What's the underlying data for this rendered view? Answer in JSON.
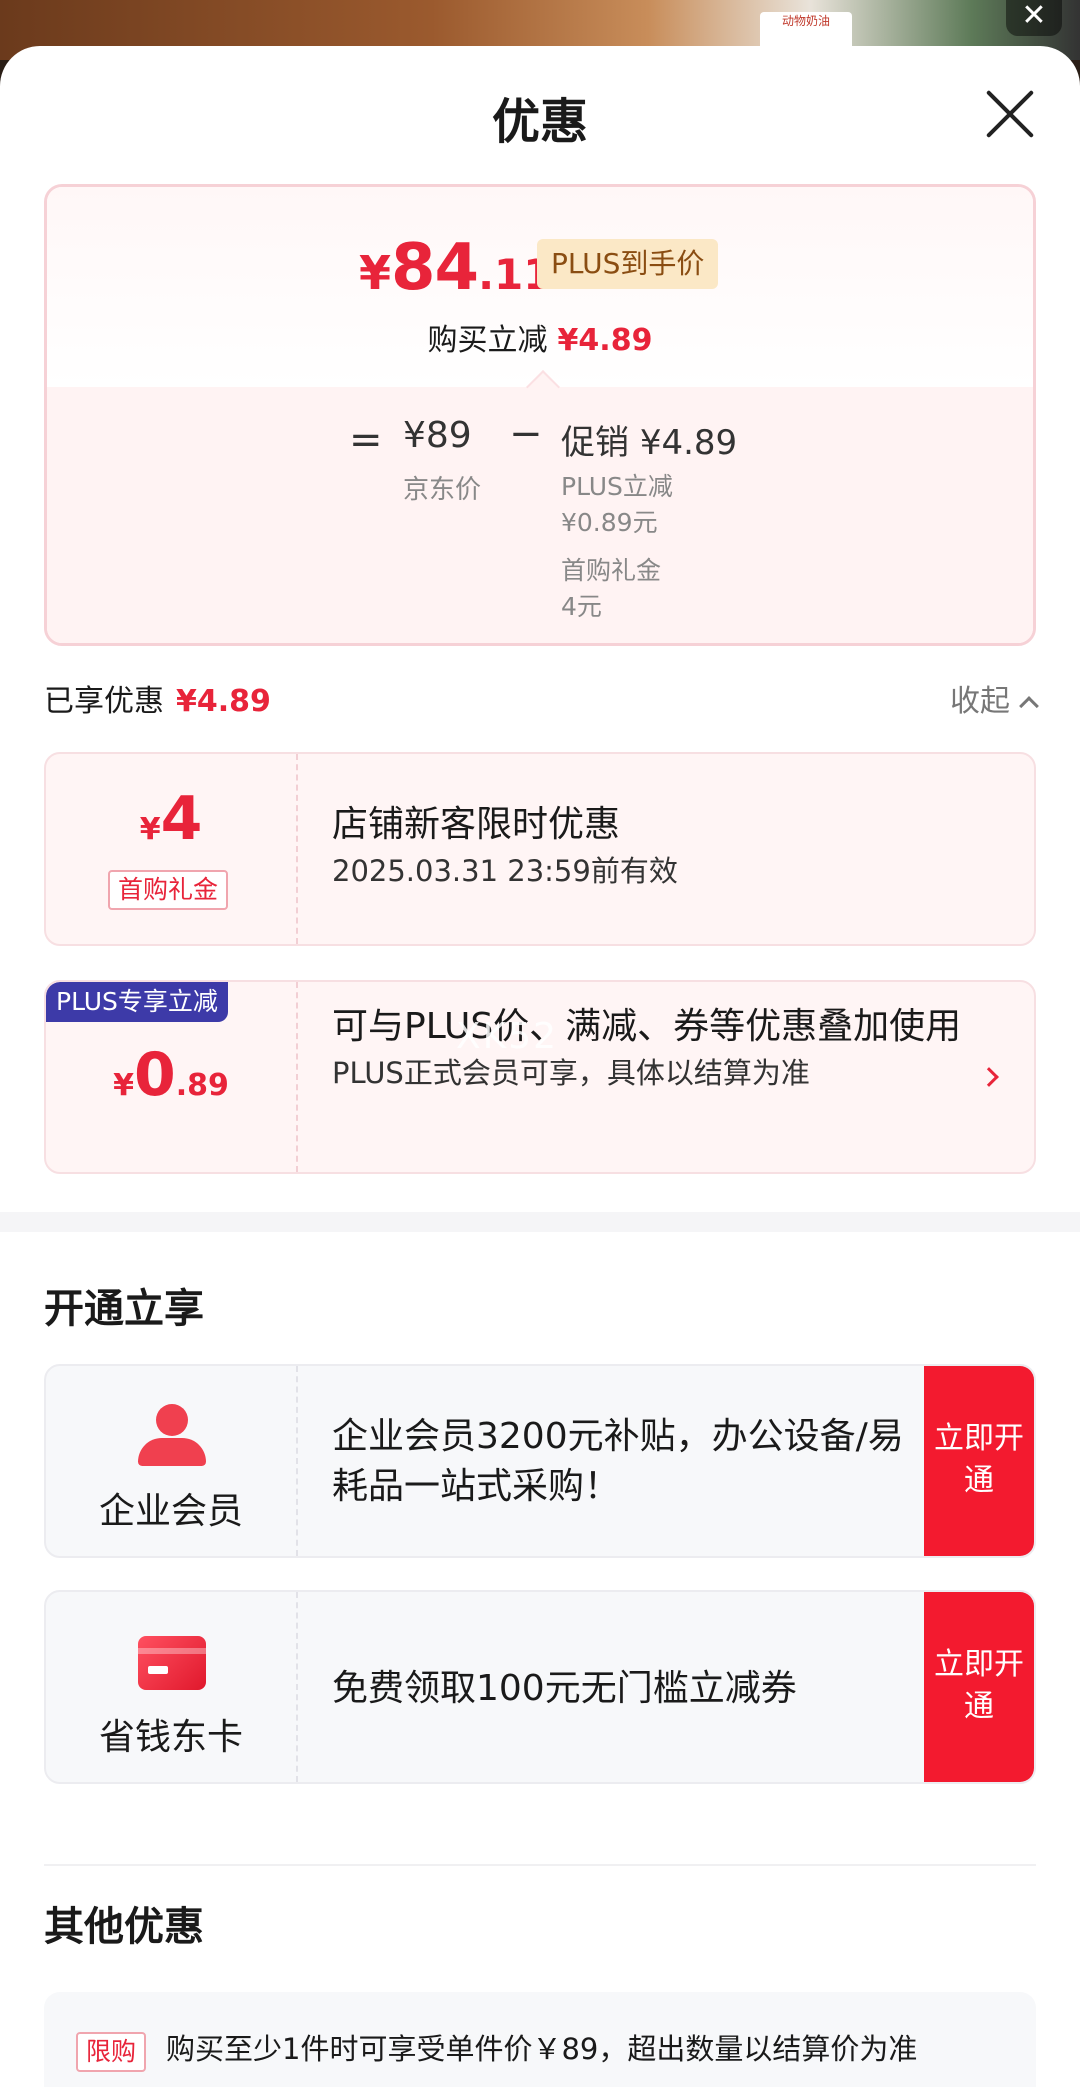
{
  "sheet": {
    "title": "优惠"
  },
  "price_card": {
    "final_price_currency": "¥",
    "final_price_integer": "84",
    "final_price_decimal": ".11",
    "plus_tag": "PLUS到手价",
    "buy_reduce_label": "购买立减",
    "buy_reduce_value": "¥4.89",
    "equals": "=",
    "jd_price": "¥89",
    "jd_price_label": "京东价",
    "minus": "−",
    "promo_label": "促销",
    "promo_value": "¥4.89",
    "promo_items": [
      {
        "name": "PLUS立减",
        "value": "¥0.89元"
      },
      {
        "name": "首购礼金",
        "value": "4元"
      }
    ]
  },
  "enjoyed": {
    "label": "已享优惠",
    "value": "¥4.89",
    "collapse_label": "收起"
  },
  "coupons": [
    {
      "currency": "¥",
      "amount_big": "4",
      "amount_small": "",
      "tag": "首购礼金",
      "title": "店铺新客限时优惠",
      "subtitle": "2025.03.31 23:59前有效"
    },
    {
      "currency": "¥",
      "amount_big": "0",
      "amount_small": ".89",
      "tag": "PLUS专享立减",
      "title": "可与PLUS价、满减、券等优惠叠加使用",
      "subtitle": "PLUS正式会员可享，具体以结算为准"
    }
  ],
  "open_section": {
    "title": "开通立享",
    "items": [
      {
        "icon": "person-icon",
        "name": "企业会员",
        "desc": "企业会员3200元补贴，办公设备/易耗品一站式采购！",
        "button": "立即开通"
      },
      {
        "icon": "card-icon",
        "name": "省钱东卡",
        "desc": "免费领取100元无门槛立减券",
        "button": "立即开通"
      }
    ]
  },
  "other_section": {
    "title": "其他优惠",
    "tag": "限购",
    "text": "购买至少1件时可享受单件价￥89，超出数量以结算价为准"
  },
  "background": {
    "tag_text": "动物奶油",
    "watermark": "XK52"
  },
  "colors": {
    "accent_red": "#e8243a",
    "button_red": "#f31a2f",
    "plus_blue": "#3d3aa8",
    "plus_gold_bg": "#fbe8c6"
  }
}
